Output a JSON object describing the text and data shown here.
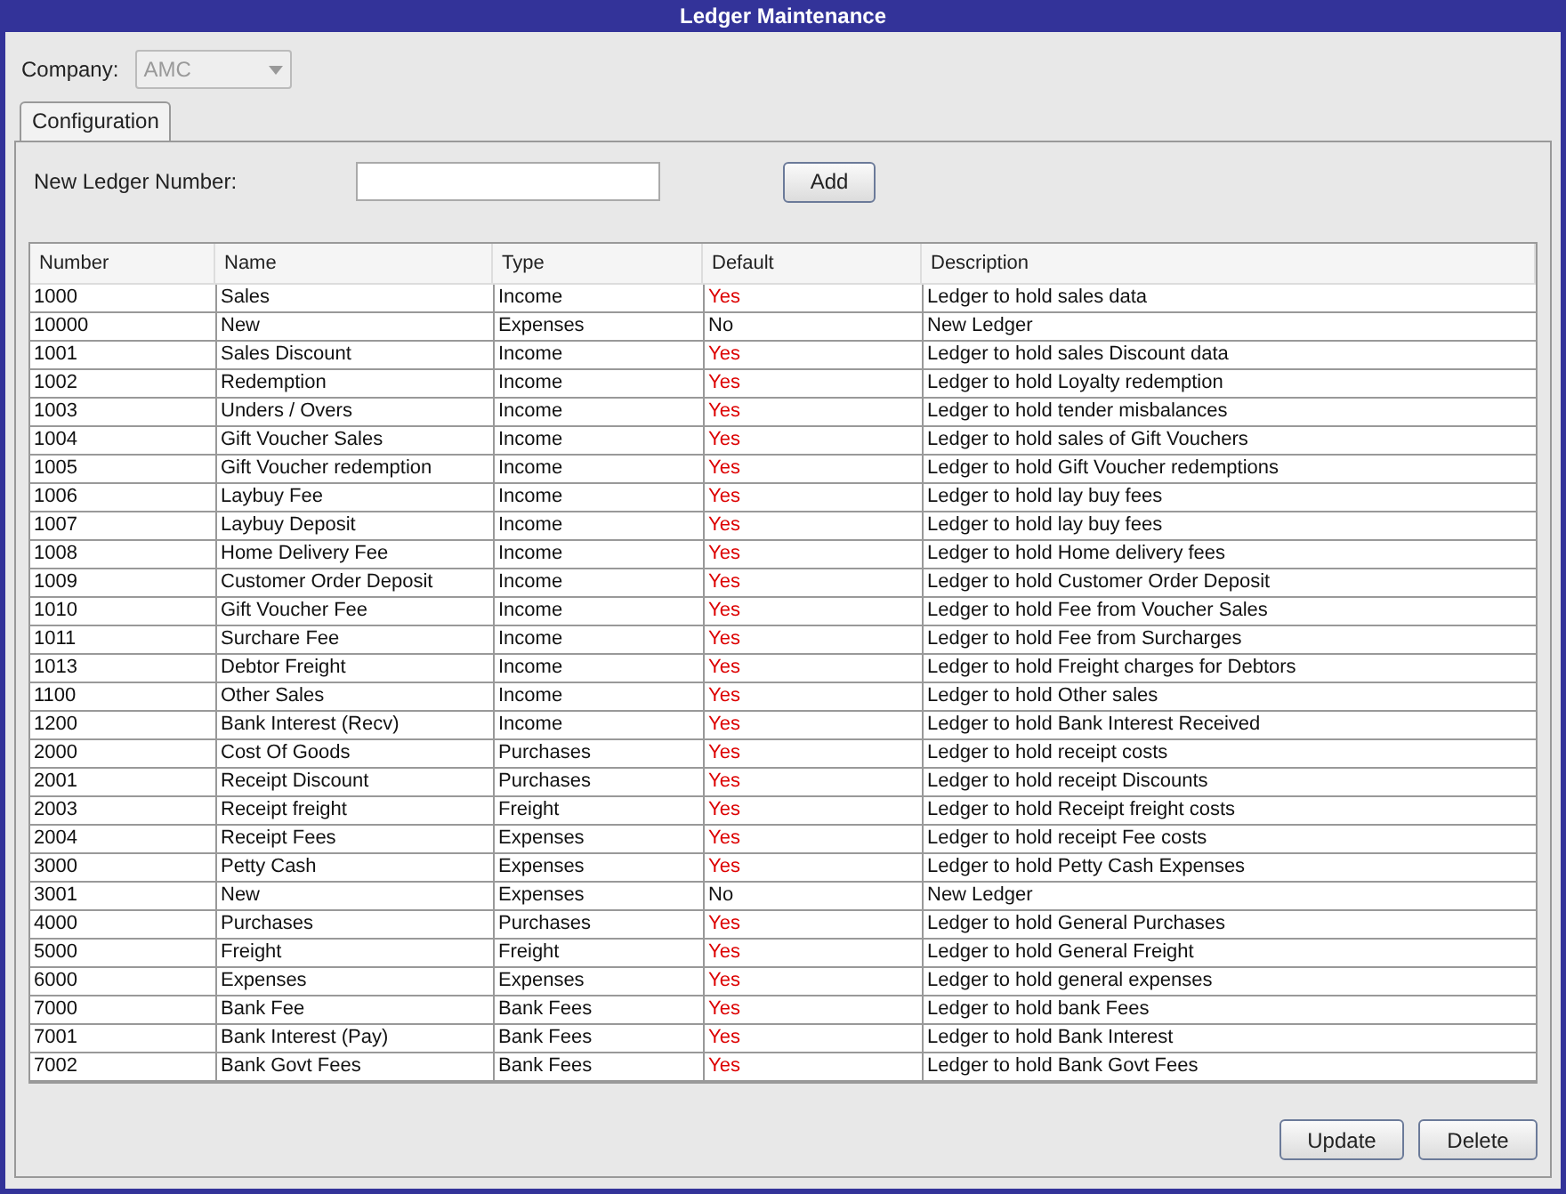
{
  "window": {
    "title": "Ledger Maintenance"
  },
  "company": {
    "label": "Company:",
    "value": "AMC",
    "disabled": true
  },
  "tabs": [
    {
      "label": "Configuration",
      "selected": true
    }
  ],
  "new_ledger": {
    "label": "New Ledger Number:",
    "button": "Add"
  },
  "table": {
    "columns": [
      "Number",
      "Name",
      "Type",
      "Default",
      "Description"
    ],
    "rows": [
      {
        "number": "1000",
        "name": "Sales",
        "type": "Income",
        "default": "Yes",
        "is_default": true,
        "description": "Ledger to hold sales data"
      },
      {
        "number": "10000",
        "name": "New",
        "type": "Expenses",
        "default": "No",
        "is_default": false,
        "description": "New Ledger"
      },
      {
        "number": "1001",
        "name": "Sales Discount",
        "type": "Income",
        "default": "Yes",
        "is_default": true,
        "description": "Ledger to hold sales Discount data"
      },
      {
        "number": "1002",
        "name": "Redemption",
        "type": "Income",
        "default": "Yes",
        "is_default": true,
        "description": "Ledger to hold Loyalty redemption"
      },
      {
        "number": "1003",
        "name": "Unders / Overs",
        "type": "Income",
        "default": "Yes",
        "is_default": true,
        "description": "Ledger to hold tender misbalances"
      },
      {
        "number": "1004",
        "name": "Gift Voucher Sales",
        "type": "Income",
        "default": "Yes",
        "is_default": true,
        "description": "Ledger to hold sales of Gift Vouchers"
      },
      {
        "number": "1005",
        "name": "Gift Voucher redemption",
        "type": "Income",
        "default": "Yes",
        "is_default": true,
        "description": "Ledger to hold Gift Voucher redemptions"
      },
      {
        "number": "1006",
        "name": "Laybuy Fee",
        "type": "Income",
        "default": "Yes",
        "is_default": true,
        "description": "Ledger to hold lay buy fees"
      },
      {
        "number": "1007",
        "name": "Laybuy Deposit",
        "type": "Income",
        "default": "Yes",
        "is_default": true,
        "description": "Ledger to hold lay buy fees"
      },
      {
        "number": "1008",
        "name": "Home Delivery Fee",
        "type": "Income",
        "default": "Yes",
        "is_default": true,
        "description": "Ledger to hold Home delivery fees"
      },
      {
        "number": "1009",
        "name": "Customer Order Deposit",
        "type": "Income",
        "default": "Yes",
        "is_default": true,
        "description": "Ledger to hold Customer Order Deposit"
      },
      {
        "number": "1010",
        "name": "Gift Voucher Fee",
        "type": "Income",
        "default": "Yes",
        "is_default": true,
        "description": "Ledger to hold Fee from Voucher Sales"
      },
      {
        "number": "1011",
        "name": "Surchare Fee",
        "type": "Income",
        "default": "Yes",
        "is_default": true,
        "description": "Ledger to hold Fee from Surcharges"
      },
      {
        "number": "1013",
        "name": "Debtor Freight",
        "type": "Income",
        "default": "Yes",
        "is_default": true,
        "description": "Ledger to hold Freight charges for Debtors"
      },
      {
        "number": "1100",
        "name": "Other Sales",
        "type": "Income",
        "default": "Yes",
        "is_default": true,
        "description": "Ledger to hold Other sales"
      },
      {
        "number": "1200",
        "name": "Bank Interest (Recv)",
        "type": "Income",
        "default": "Yes",
        "is_default": true,
        "description": "Ledger to hold Bank Interest Received"
      },
      {
        "number": "2000",
        "name": "Cost Of Goods",
        "type": "Purchases",
        "default": "Yes",
        "is_default": true,
        "description": "Ledger to hold receipt costs"
      },
      {
        "number": "2001",
        "name": "Receipt Discount",
        "type": "Purchases",
        "default": "Yes",
        "is_default": true,
        "description": "Ledger to hold receipt Discounts"
      },
      {
        "number": "2003",
        "name": "Receipt freight",
        "type": "Freight",
        "default": "Yes",
        "is_default": true,
        "description": "Ledger to hold Receipt freight costs"
      },
      {
        "number": "2004",
        "name": "Receipt Fees",
        "type": "Expenses",
        "default": "Yes",
        "is_default": true,
        "description": "Ledger to hold receipt Fee costs"
      },
      {
        "number": "3000",
        "name": "Petty Cash",
        "type": "Expenses",
        "default": "Yes",
        "is_default": true,
        "description": "Ledger to hold Petty Cash Expenses"
      },
      {
        "number": "3001",
        "name": "New",
        "type": "Expenses",
        "default": "No",
        "is_default": false,
        "description": "New Ledger"
      },
      {
        "number": "4000",
        "name": "Purchases",
        "type": "Purchases",
        "default": "Yes",
        "is_default": true,
        "description": "Ledger to hold General Purchases"
      },
      {
        "number": "5000",
        "name": "Freight",
        "type": "Freight",
        "default": "Yes",
        "is_default": true,
        "description": "Ledger to hold General Freight"
      },
      {
        "number": "6000",
        "name": "Expenses",
        "type": "Expenses",
        "default": "Yes",
        "is_default": true,
        "description": "Ledger to hold general expenses"
      },
      {
        "number": "7000",
        "name": "Bank Fee",
        "type": "Bank Fees",
        "default": "Yes",
        "is_default": true,
        "description": "Ledger to hold bank Fees"
      },
      {
        "number": "7001",
        "name": "Bank Interest (Pay)",
        "type": "Bank Fees",
        "default": "Yes",
        "is_default": true,
        "description": "Ledger to hold Bank Interest"
      },
      {
        "number": "7002",
        "name": "Bank Govt Fees",
        "type": "Bank Fees",
        "default": "Yes",
        "is_default": true,
        "description": "Ledger to hold Bank Govt Fees"
      }
    ]
  },
  "buttons": [
    "Update",
    "Delete"
  ]
}
